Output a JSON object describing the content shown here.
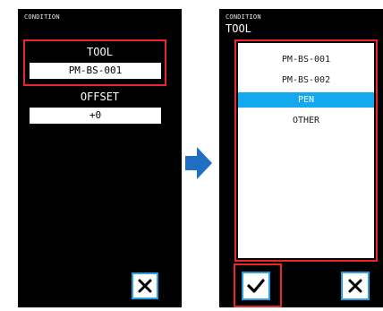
{
  "left_screen": {
    "header_label": "CONDITION",
    "tool": {
      "label": "TOOL",
      "value": "PM-BS-001"
    },
    "offset": {
      "label": "OFFSET",
      "value": "+0"
    },
    "close_icon": "close-x-icon"
  },
  "right_screen": {
    "header_label": "CONDITION",
    "title": "TOOL",
    "options": [
      "PM-BS-001",
      "PM-BS-002",
      "PEN",
      "OTHER"
    ],
    "selected_option": "PEN",
    "confirm_icon": "checkmark-icon",
    "close_icon": "close-x-icon"
  },
  "colors": {
    "highlight": "#e8272c",
    "accent": "#14a8ee",
    "button_border": "#28a0e0",
    "arrow": "#1f6fc4"
  }
}
